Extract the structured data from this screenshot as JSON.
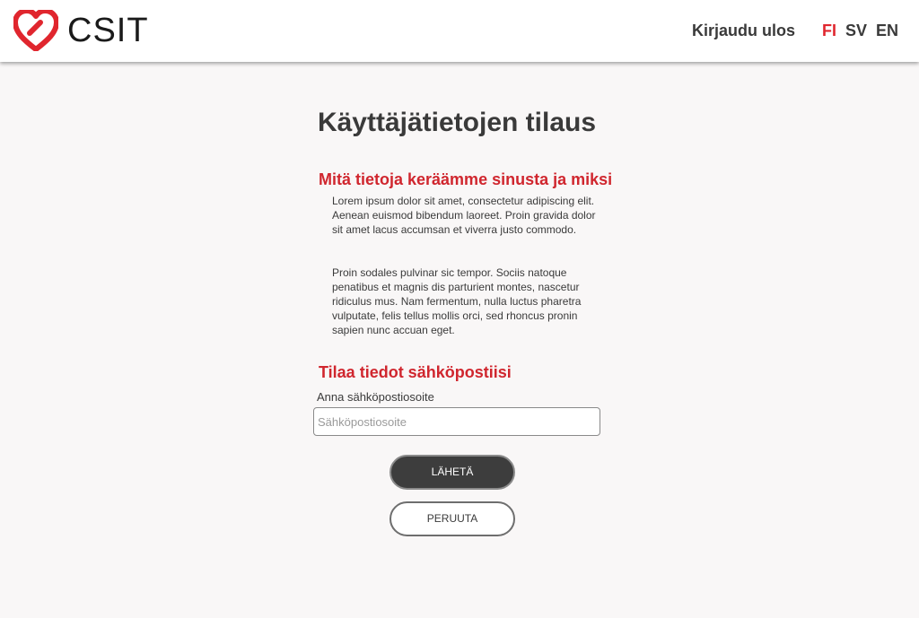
{
  "header": {
    "logo_text": "CSIT",
    "logout_label": "Kirjaudu ulos",
    "languages": [
      "FI",
      "SV",
      "EN"
    ],
    "active_language": "FI"
  },
  "main": {
    "title": "Käyttäjätietojen tilaus",
    "section1": {
      "heading": "Mitä tietoja keräämme sinusta ja miksi",
      "paragraphs": [
        "Lorem ipsum dolor sit amet, consectetur adipiscing elit. Aenean euismod bibendum laoreet. Proin gravida dolor sit amet lacus accumsan et viverra justo commodo.",
        "Proin sodales pulvinar sic tempor. Sociis natoque penatibus et magnis dis parturient montes, nascetur ridiculus mus. Nam fermentum, nulla luctus pharetra vulputate, felis tellus mollis orci, sed rhoncus pronin sapien nunc accuan eget."
      ]
    },
    "section2": {
      "heading": "Tilaa tiedot sähköpostiisi",
      "field_label": "Anna sähköpostiosoite",
      "email_value": "",
      "email_placeholder": "Sähköpostiosoite"
    },
    "buttons": {
      "send_label": "LÄHETÄ",
      "cancel_label": "PERUUTA"
    }
  },
  "colors": {
    "accent": "#d0262e",
    "background": "#f9f7f7",
    "dark_button": "#3d3d3d"
  }
}
